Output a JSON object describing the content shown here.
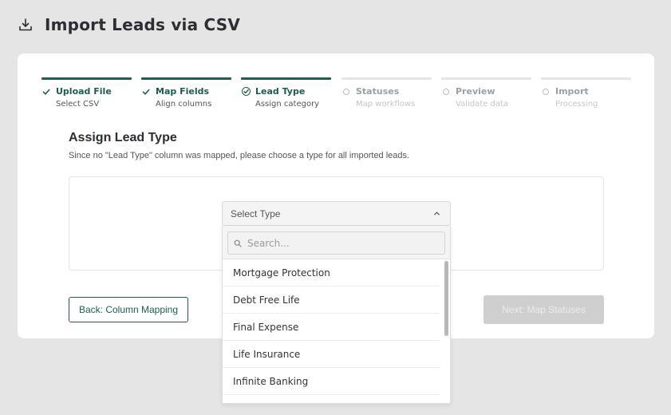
{
  "header": {
    "title": "Import Leads via CSV",
    "icon": "download-icon"
  },
  "steps": [
    {
      "title": "Upload File",
      "subtitle": "Select CSV",
      "state": "done"
    },
    {
      "title": "Map Fields",
      "subtitle": "Align columns",
      "state": "done"
    },
    {
      "title": "Lead Type",
      "subtitle": "Assign category",
      "state": "active"
    },
    {
      "title": "Statuses",
      "subtitle": "Map workflows",
      "state": "pending"
    },
    {
      "title": "Preview",
      "subtitle": "Validate data",
      "state": "pending"
    },
    {
      "title": "Import",
      "subtitle": "Processing",
      "state": "pending"
    }
  ],
  "section": {
    "title": "Assign Lead Type",
    "description": "Since no \"Lead Type\" column was mapped, please choose a type for all imported leads."
  },
  "select": {
    "value": "Select Type",
    "search_placeholder": "Search..."
  },
  "options": [
    "Mortgage Protection",
    "Debt Free Life",
    "Final Expense",
    "Life Insurance",
    "Infinite Banking"
  ],
  "buttons": {
    "back": "Back: Column Mapping",
    "next": "Next: Map Statuses"
  },
  "colors": {
    "accent": "#1f5e52",
    "disabled": "#cfcfcf",
    "background": "#e5e5e5"
  }
}
